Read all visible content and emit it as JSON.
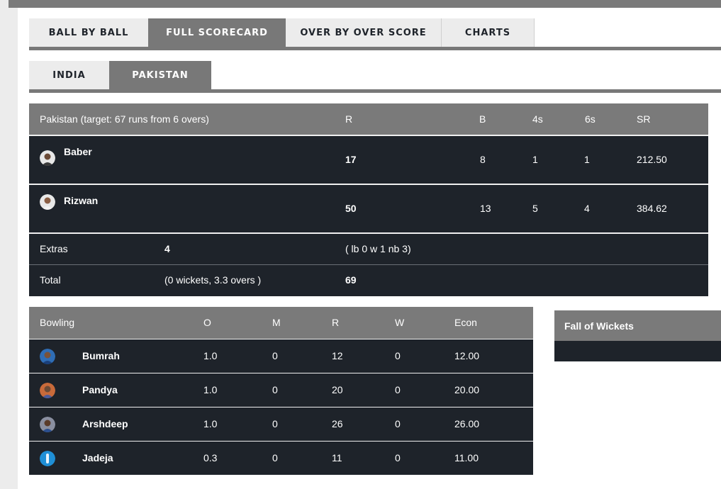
{
  "tabs": [
    {
      "label": "BALL BY BALL",
      "active": false
    },
    {
      "label": "FULL SCORECARD",
      "active": true
    },
    {
      "label": "OVER BY OVER SCORE",
      "active": false
    },
    {
      "label": "CHARTS",
      "active": false
    }
  ],
  "teams": [
    {
      "label": "INDIA",
      "active": false
    },
    {
      "label": "PAKISTAN",
      "active": true
    }
  ],
  "batting": {
    "header": {
      "title": "Pakistan (target: 67 runs from 6 overs)",
      "r": "R",
      "b": "B",
      "fours": "4s",
      "sixes": "6s",
      "sr": "SR"
    },
    "players": [
      {
        "name": "Baber",
        "r": "17",
        "b": "8",
        "fours": "1",
        "sixes": "1",
        "sr": "212.50"
      },
      {
        "name": "Rizwan",
        "r": "50",
        "b": "13",
        "fours": "5",
        "sixes": "4",
        "sr": "384.62"
      }
    ],
    "extras": {
      "label": "Extras",
      "value": "4",
      "detail": "( lb 0 w 1 nb 3)"
    },
    "total": {
      "label": "Total",
      "detail": "(0 wickets, 3.3 overs )",
      "value": "69"
    }
  },
  "bowling": {
    "header": {
      "title": "Bowling",
      "o": "O",
      "m": "M",
      "r": "R",
      "w": "W",
      "econ": "Econ"
    },
    "players": [
      {
        "name": "Bumrah",
        "o": "1.0",
        "m": "0",
        "r": "12",
        "w": "0",
        "econ": "12.00"
      },
      {
        "name": "Pandya",
        "o": "1.0",
        "m": "0",
        "r": "20",
        "w": "0",
        "econ": "20.00"
      },
      {
        "name": "Arshdeep",
        "o": "1.0",
        "m": "0",
        "r": "26",
        "w": "0",
        "econ": "26.00"
      },
      {
        "name": "Jadeja",
        "o": "0.3",
        "m": "0",
        "r": "11",
        "w": "0",
        "econ": "11.00"
      }
    ]
  },
  "fall_of_wickets": {
    "title": "Fall of Wickets"
  },
  "colors": {
    "header_grey": "#7a7a7a",
    "row_dark": "#1e232a",
    "tab_light": "#ececec"
  }
}
